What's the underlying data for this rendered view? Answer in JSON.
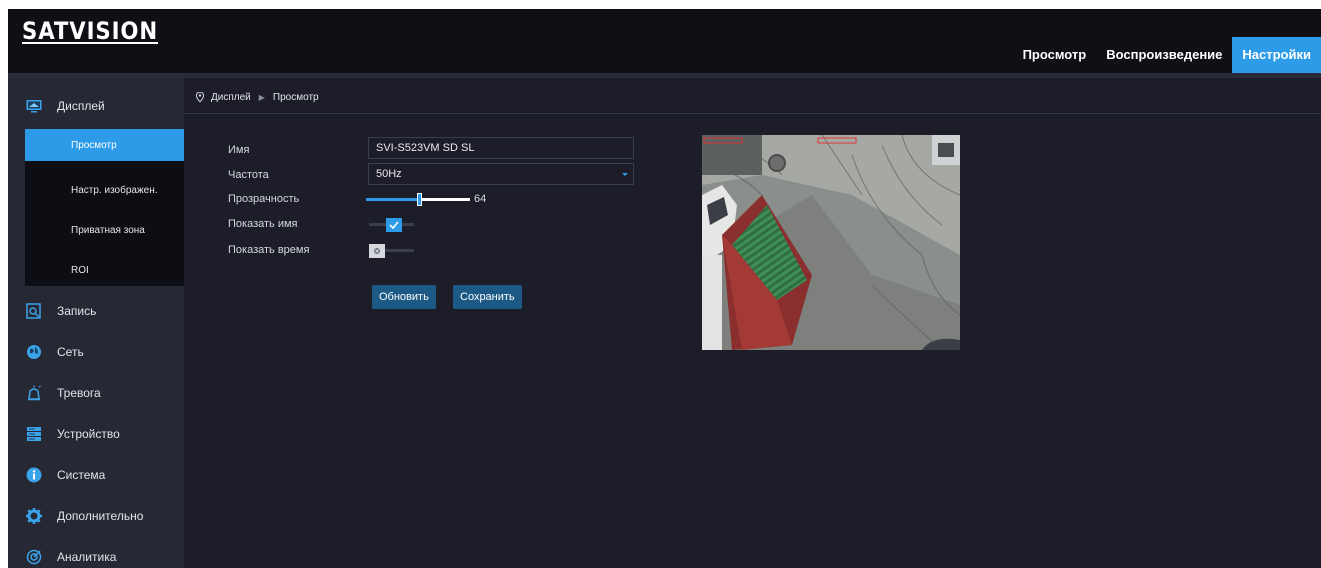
{
  "brand": {
    "logo": "SATVISION"
  },
  "nav": {
    "tabs": [
      "Просмотр",
      "Воспроизведение",
      "Настройки"
    ],
    "active": "Настройки"
  },
  "sidebar": {
    "items": [
      {
        "label": "Дисплей",
        "icon": "monitor-icon"
      },
      {
        "label": "Запись",
        "icon": "record-search-icon"
      },
      {
        "label": "Сеть",
        "icon": "globe-icon"
      },
      {
        "label": "Тревога",
        "icon": "alarm-siren-icon"
      },
      {
        "label": "Устройство",
        "icon": "device-storage-icon"
      },
      {
        "label": "Система",
        "icon": "info-icon"
      },
      {
        "label": "Дополнительно",
        "icon": "gear-icon"
      },
      {
        "label": "Аналитика",
        "icon": "analytics-icon"
      }
    ],
    "sub_items": [
      "Просмотр",
      "Настр. изображен.",
      "Приватная зона",
      "ROI"
    ],
    "active_sub": "Просмотр"
  },
  "breadcrumb": {
    "parent": "Дисплей",
    "current": "Просмотр"
  },
  "form": {
    "name_label": "Имя",
    "name_value": "SVI-S523VM SD SL",
    "freq_label": "Частота",
    "freq_value": "50Hz",
    "transparency_label": "Прозрачность",
    "transparency_value": "64",
    "transparency_fraction": 0.52,
    "show_name_label": "Показать имя",
    "show_name_on": true,
    "show_time_label": "Показать время",
    "show_time_on": false,
    "refresh_button": "Обновить",
    "save_button": "Сохранить"
  },
  "colors": {
    "accent": "#2d9be8",
    "button": "#1c5a85",
    "background": "#1c1d28",
    "header": "#0f1016",
    "sidebar": "#262834"
  }
}
